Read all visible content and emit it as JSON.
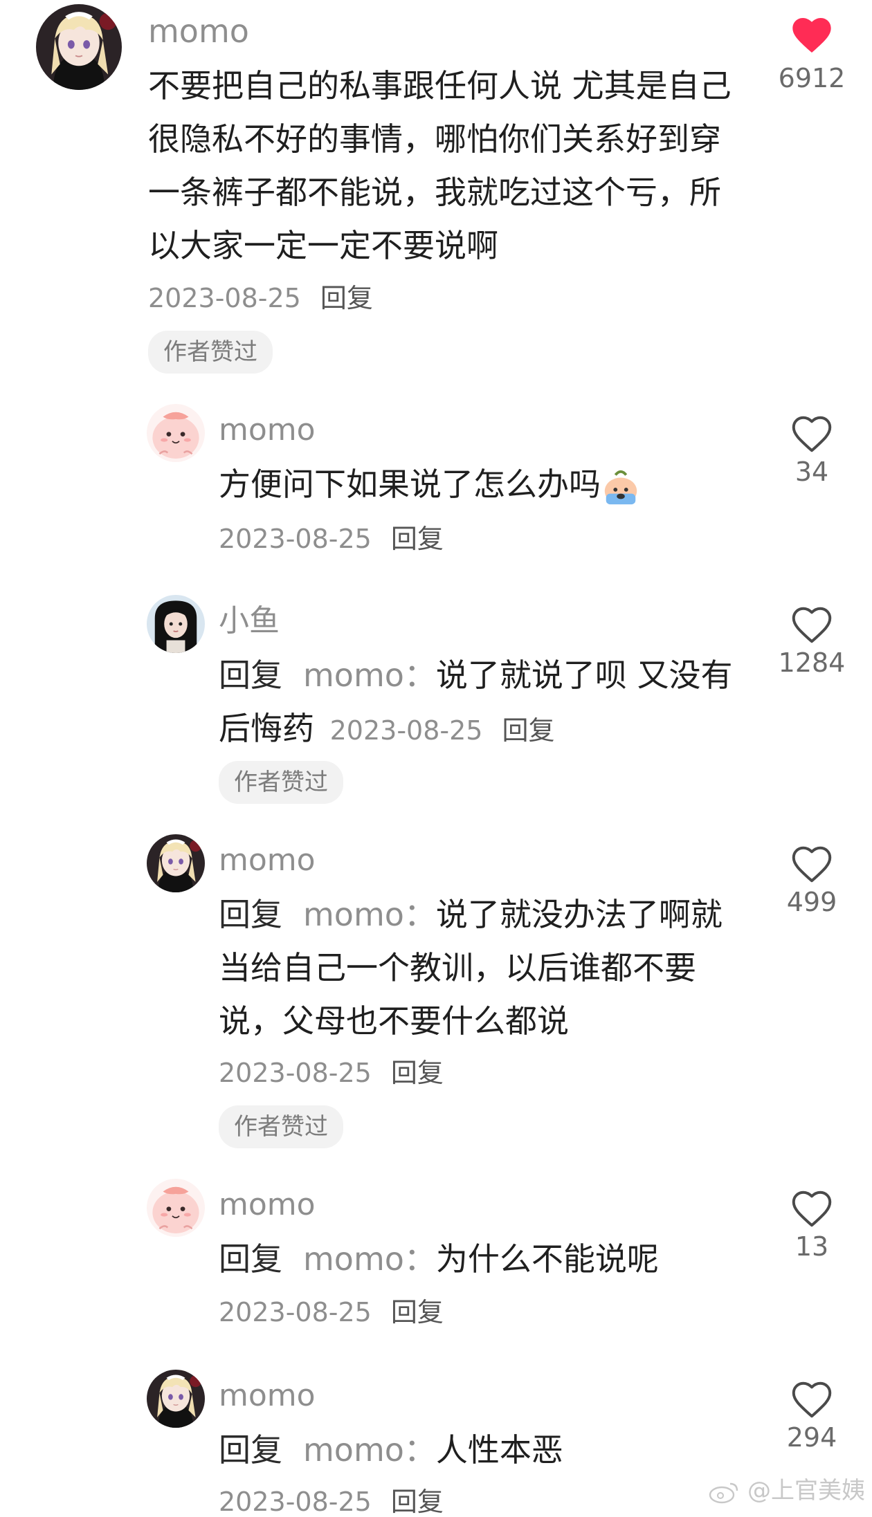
{
  "colors": {
    "like_active": "#ff2c55",
    "text": "#1f1f1f",
    "muted": "#8e8e8e"
  },
  "comments": [
    {
      "username": "momo",
      "text": "不要把自己的私事跟任何人说 尤其是自己很隐私不好的事情，哪怕你们关系好到穿一条裤子都不能说，我就吃过这个亏，所以大家一定一定不要说啊",
      "date": "2023-08-25",
      "reply_label": "回复",
      "author_liked": "作者赞过",
      "likes": "6912",
      "liked": true,
      "avatar": "anime-girl-avatar"
    },
    {
      "username": "momo",
      "text": "方便问下如果说了怎么办吗",
      "emoji": "crying-emoji",
      "date": "2023-08-25",
      "reply_label": "回复",
      "likes": "34",
      "avatar": "pink-blob-avatar"
    },
    {
      "username": "小鱼",
      "reply_prefix": "回复",
      "reply_to": "momo：",
      "text": "说了就说了呗 又没有后悔药",
      "date": "2023-08-25",
      "reply_label": "回复",
      "author_liked": "作者赞过",
      "likes": "1284",
      "avatar": "dark-hair-girl-avatar"
    },
    {
      "username": "momo",
      "reply_prefix": "回复",
      "reply_to": "momo：",
      "text": "说了就没办法了啊就当给自己一个教训，以后谁都不要说，父母也不要什么都说",
      "date": "2023-08-25",
      "reply_label": "回复",
      "author_liked": "作者赞过",
      "likes": "499",
      "avatar": "anime-girl-avatar"
    },
    {
      "username": "momo",
      "reply_prefix": "回复",
      "reply_to": "momo：",
      "text": "为什么不能说呢",
      "date": "2023-08-25",
      "reply_label": "回复",
      "likes": "13",
      "avatar": "pink-blob-avatar"
    },
    {
      "username": "momo",
      "reply_prefix": "回复",
      "reply_to": "momo：",
      "text": "人性本恶",
      "date": "2023-08-25",
      "reply_label": "回复",
      "likes": "294",
      "avatar": "anime-girl-avatar"
    }
  ],
  "watermark": "@上官美姨"
}
